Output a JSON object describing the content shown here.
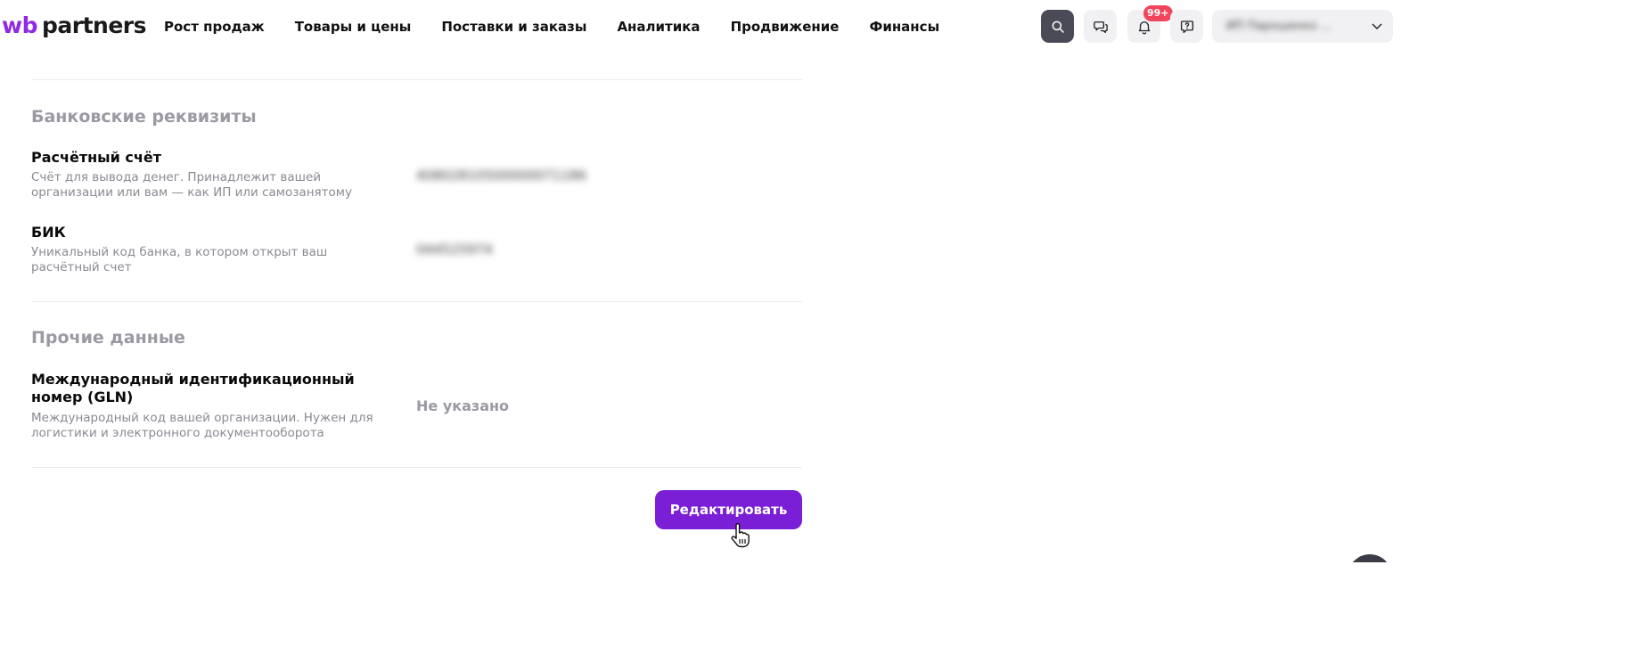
{
  "header": {
    "logo_wb": "wb",
    "logo_partners": "partners",
    "nav": [
      {
        "label": "Рост продаж"
      },
      {
        "label": "Товары и цены"
      },
      {
        "label": "Поставки и заказы"
      },
      {
        "label": "Аналитика"
      },
      {
        "label": "Продвижение"
      },
      {
        "label": "Финансы"
      }
    ],
    "notifications_badge": "99+",
    "account_name": "ИП Парошенко ...",
    "icons": [
      "search-icon",
      "chat-icon",
      "bell-icon",
      "help-icon",
      "chevron-down-icon"
    ]
  },
  "bank": {
    "title": "Банковские реквизиты",
    "account": {
      "label": "Расчётный счёт",
      "description": "Счёт для вывода денег. Принадлежит вашей организации или вам — как ИП или самозанятому",
      "value": "40802810500000071186"
    },
    "bik": {
      "label": "БИК",
      "description": "Уникальный код банка, в котором открыт ваш расчётный счет",
      "value": "044525974"
    }
  },
  "other": {
    "title": "Прочие данные",
    "gln": {
      "label": "Международный идентификационный номер (GLN)",
      "description": "Международный код вашей организации. Нужен для логистики и электронного документооборота",
      "value": "Не указано"
    }
  },
  "actions": {
    "edit_label": "Редактировать"
  },
  "colors": {
    "brand": "#8f2ae6",
    "button": "#7a1fd6",
    "badge": "#f1455b",
    "muted": "#9a9aa3"
  }
}
